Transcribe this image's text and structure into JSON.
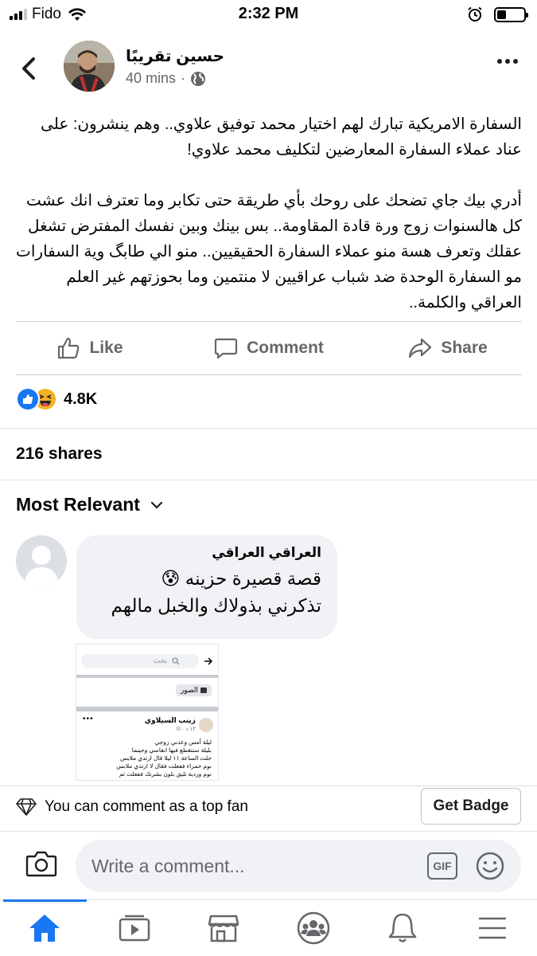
{
  "status_bar": {
    "carrier": "Fido",
    "time": "2:32 PM",
    "battery_level": 0.35
  },
  "post": {
    "author": "حسين تقريبًا",
    "time_ago": "40 mins",
    "privacy_icon": "globe-icon",
    "paragraphs": [
      "السفارة الامريكية تبارك لهم اختيار محمد توفيق علاوي.. وهم ينشرون: على عناد عملاء السفارة المعارضين لتكليف محمد علاوي!",
      "أدري بيك جاي تضحك على روحك بأي طريقة حتى تكابر وما تعترف انك عشت كل هالسنوات زوج ورة قادة المقاومة.. بس بينك وبين نفسك المفترض تشغل عقلك وتعرف هسة منو عملاء السفارة الحقيقيين.. منو الي طابگ وية السفارات مو السفارة الوحدة ضد شباب عراقيين لا منتمين وما بحوزتهم غير العلم العراقي والكلمة.."
    ],
    "actions": {
      "like": "Like",
      "comment": "Comment",
      "share": "Share"
    },
    "reaction_count": "4.8K",
    "shares": "216 shares"
  },
  "comments": {
    "sort_label": "Most Relevant",
    "items": [
      {
        "author": "العراقي العراقي",
        "line1": "قصة قصيرة حزينه 😰",
        "line2": "تذكرني بذولاك والخبل مالهم",
        "attachment": {
          "search_placeholder": "بحث",
          "photos_label": "الصور",
          "post_author": "زينب السيلاوي",
          "post_time": "١٢ د · ⊙",
          "lines": [
            "ليلة أمس وعدني زوجي",
            "بليلة سنتقطع فيها انفاسي وحينما",
            "حلت الساعة ١١ ليلا قال ارتدي ملابس",
            "نوم حمراء ففعلت فقال لا ارتدي ملابس",
            "نوم وردية تليق بلون بشرتك ففعلت ثم"
          ]
        }
      }
    ]
  },
  "top_fan": {
    "text": "You can comment as a top fan",
    "button": "Get Badge"
  },
  "composer": {
    "placeholder": "Write a comment...",
    "gif_label": "GIF"
  },
  "nav": {
    "items": [
      "home-icon",
      "watch-icon",
      "marketplace-icon",
      "groups-icon",
      "notifications-icon",
      "menu-icon"
    ],
    "active": "home-icon"
  },
  "colors": {
    "brand": "#1877f2",
    "muted_text": "#65676b",
    "bubble": "#f0f2f5"
  }
}
